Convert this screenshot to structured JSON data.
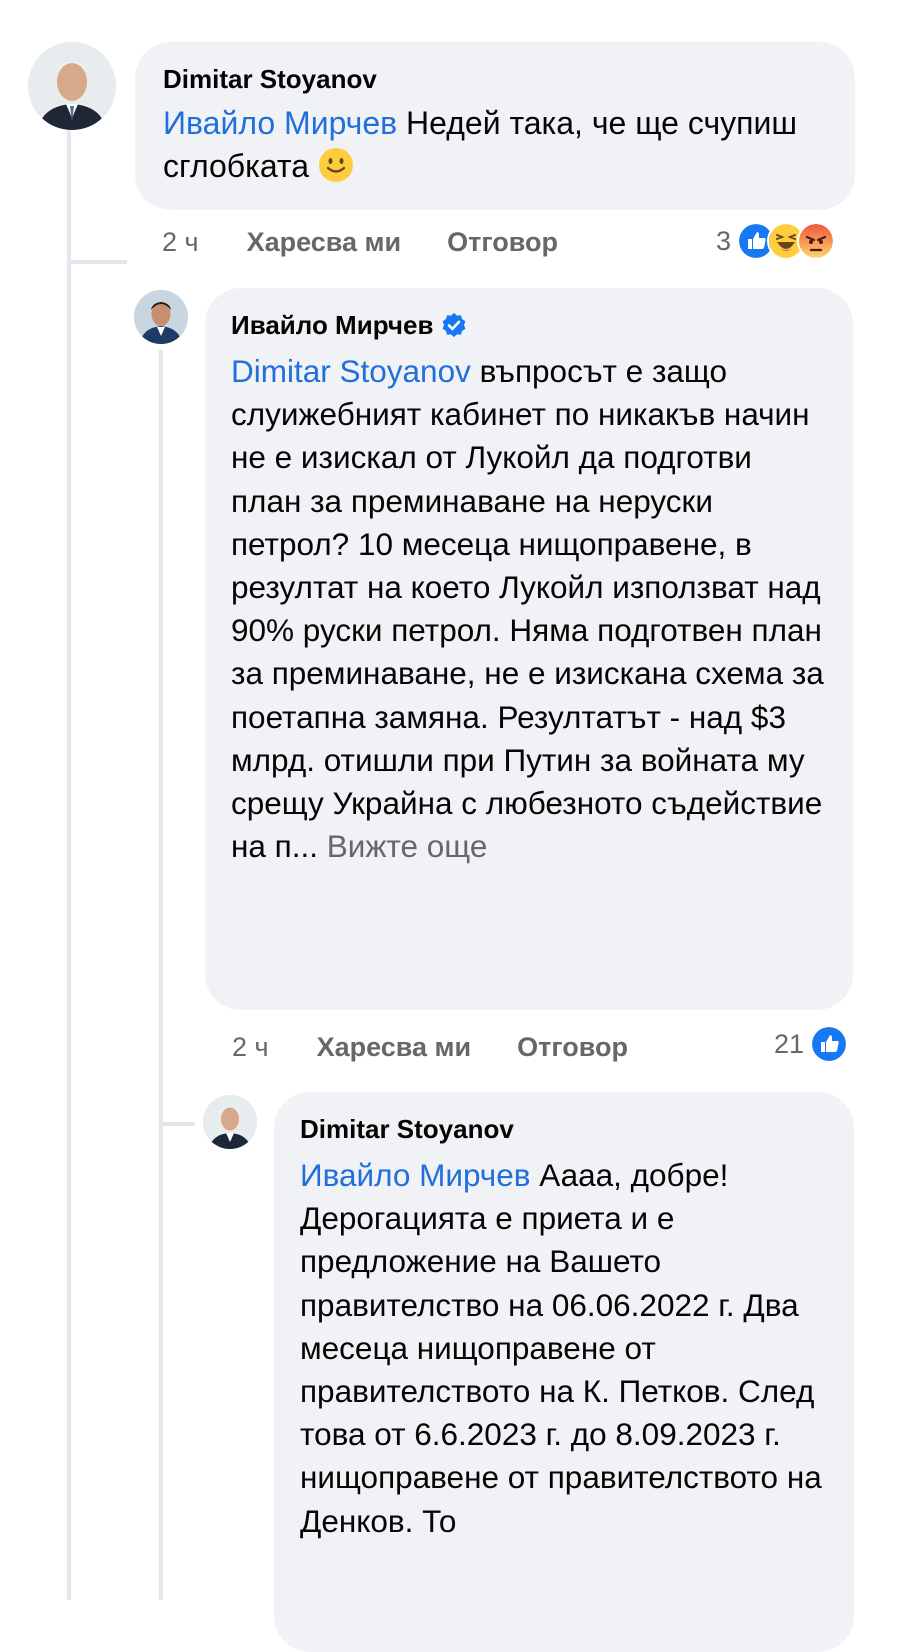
{
  "comments": [
    {
      "author": "Dimitar Stoyanov",
      "mention": "Ивайло Мирчев",
      "text": " Недей така, че ще счупиш сглобката ",
      "emoji": "slightly-smiling-face",
      "time": "2 ч",
      "like_label": "Харесва ми",
      "reply_label": "Отговор",
      "reaction_count": "3",
      "reaction_icons": [
        "like-icon",
        "haha-icon",
        "angry-icon"
      ]
    },
    {
      "author": "Ивайло Мирчев",
      "verified": true,
      "mention": "Dimitar Stoyanov",
      "text": " въпросът е защо слуижебният кабинет по никакъв начин не е изискал от Лукойл да подготви план за преминаване на неруски петрол? 10 месеца нищоправене, в резултат на което Лукойл използват над 90% руски петрол. Няма подготвен план за преминаване, не е изискана схема за поетапна замяна. Резултатът - над $3 млрд. отишли при Путин за войната му срещу Украйна с любезното съдействие на п... ",
      "see_more": "Вижте още",
      "time": "2 ч",
      "like_label": "Харесва ми",
      "reply_label": "Отговор",
      "reaction_count": "21",
      "reaction_icons": [
        "like-icon"
      ]
    },
    {
      "author": "Dimitar Stoyanov",
      "mention": "Ивайло Мирчев",
      "text": " Аааа, добре! Дерогацията е приета и е предложение на Вашето правителство на 06.06.2022 г. Два месеца нищоправене от правителството на К. Петков. След това от 6.6.2023 г. до 8.09.2023 г. нищоправене от правителството на Денков. То"
    }
  ],
  "colors": {
    "bubble": "#f0f2f5",
    "mention": "#216fdb",
    "meta": "#65676b",
    "like": "#1877f2",
    "verified": "#1877f2"
  }
}
